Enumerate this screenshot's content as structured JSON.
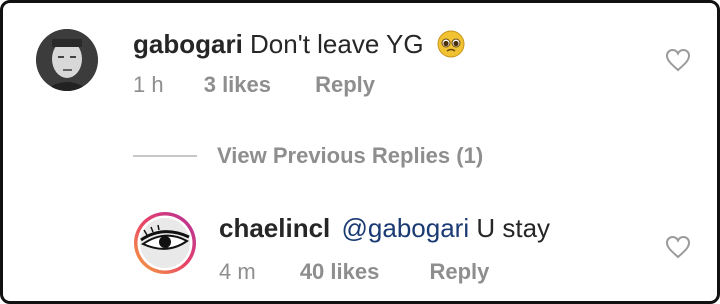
{
  "comments": [
    {
      "username": "gabogari",
      "text": "Don't leave YG",
      "emoji": "pleading-face-emoji",
      "time": "1 h",
      "likes": "3 likes",
      "reply_label": "Reply"
    }
  ],
  "view_previous": "View Previous Replies (1)",
  "replies": [
    {
      "username": "chaelincl",
      "mention": "@gabogari",
      "text": "U stay",
      "time": "4 m",
      "likes": "40 likes",
      "reply_label": "Reply"
    }
  ],
  "colors": {
    "text": "#262626",
    "muted": "#8e8e8e",
    "mention": "#1a3a73"
  }
}
